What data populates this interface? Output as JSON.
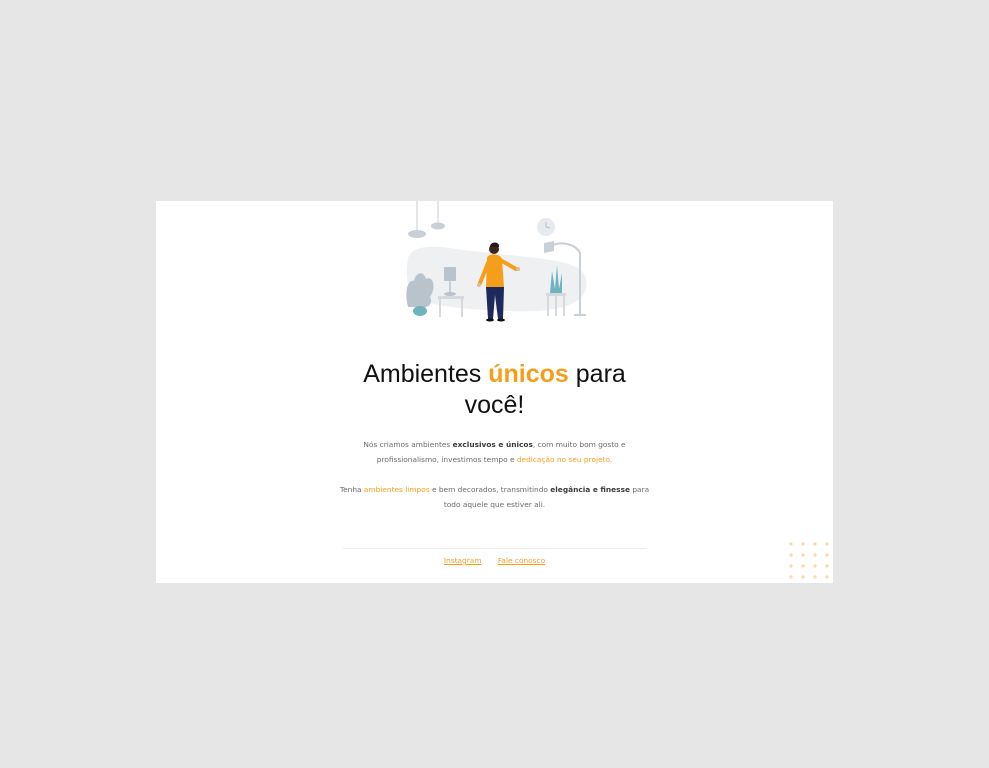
{
  "headline": {
    "part1": "Ambientes ",
    "accent": "únicos",
    "part2": " para",
    "line2": "você!"
  },
  "paragraph1": {
    "t1": "Nós criamos ambientes ",
    "b1": "exclusivos e únicos",
    "t2": ", com muito bom gosto e profissionalismo, investimos tempo e ",
    "hl1": "dedicação no seu projeto."
  },
  "paragraph2": {
    "t1": "Tenha ",
    "hl1": "ambientes limpos",
    "t2": " e bem decorados, transmitindo ",
    "b1": "elegância e finesse",
    "t3": " para todo aquele que estiver ali."
  },
  "footer": {
    "instagram_label": "Instagram",
    "contact_label": "Fale conosco"
  },
  "colors": {
    "accent": "#f59e1c",
    "page_background": "#e6e6e6",
    "card_background": "#ffffff"
  },
  "icons": [
    "room-illustration",
    "dot-grid-decoration"
  ]
}
